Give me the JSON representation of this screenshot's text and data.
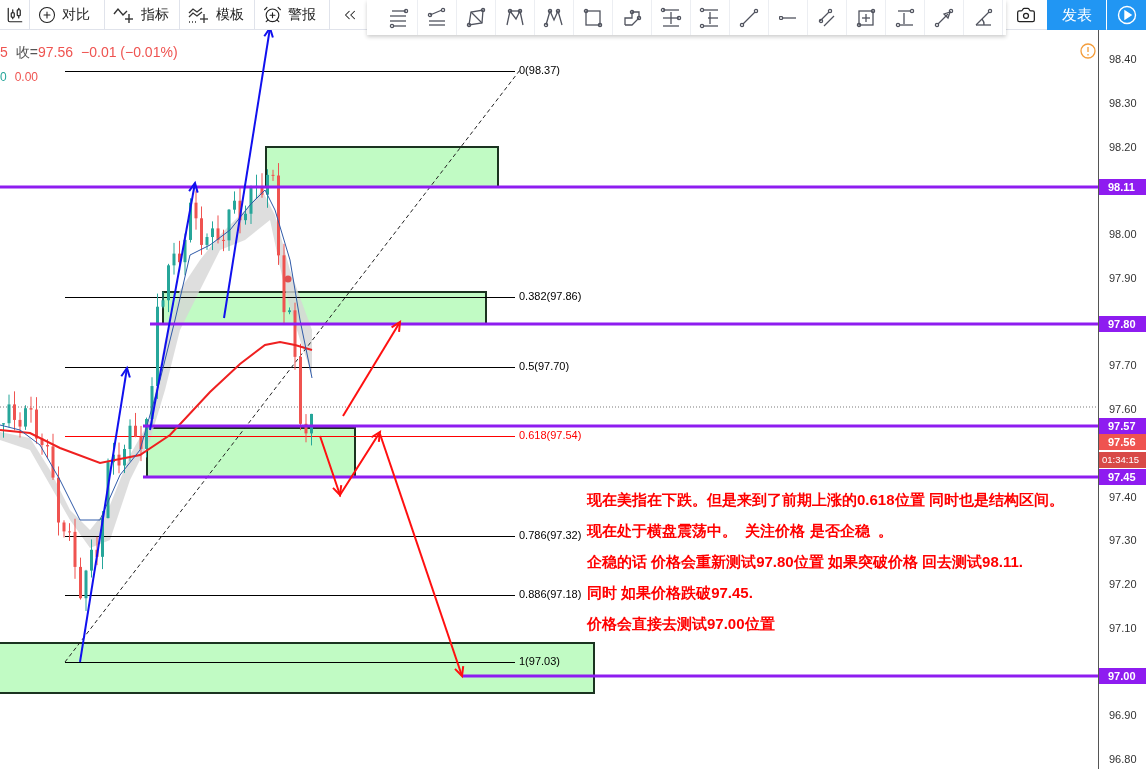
{
  "toolbar": {
    "items": [
      {
        "kind": "candles"
      },
      {
        "kind": "compare",
        "label": "对比"
      },
      {
        "kind": "indicator",
        "label": "指标"
      },
      {
        "kind": "template",
        "label": "模板"
      },
      {
        "kind": "alert",
        "label": "警报"
      },
      {
        "kind": "rewind"
      }
    ]
  },
  "publish_button": {
    "label": "发表"
  },
  "legend": {
    "period": "5",
    "close_label": "收=",
    "close": "97.56",
    "change": "−0.01 (−0.01%)",
    "indicator_prefix": "0",
    "indicator_value": "0.00"
  },
  "fib_levels": [
    {
      "label": "0(98.37)",
      "color": "#000000"
    },
    {
      "label": "0.382(97.86)",
      "color": "#000000"
    },
    {
      "label": "0.5(97.70)",
      "color": "#000000"
    },
    {
      "label": "0.618(97.54)",
      "color": "#ff0000"
    },
    {
      "label": "0.786(97.32)",
      "color": "#000000"
    },
    {
      "label": "0.886(97.18)",
      "color": "#000000"
    },
    {
      "label": "1(97.03)",
      "color": "#000000"
    }
  ],
  "price_axis": {
    "ticks": [
      "98.40",
      "98.30",
      "98.20",
      "98.00",
      "97.90",
      "97.70",
      "97.60",
      "97.40",
      "97.30",
      "97.20",
      "97.10",
      "96.90",
      "96.80"
    ],
    "tags": [
      {
        "kind": "line",
        "label": "98.11"
      },
      {
        "kind": "line",
        "label": "97.80"
      },
      {
        "kind": "line",
        "label": "97.57"
      },
      {
        "kind": "price",
        "label": "97.56"
      },
      {
        "kind": "countdown",
        "label": "01:34:15"
      },
      {
        "kind": "line",
        "label": "97.45"
      },
      {
        "kind": "line",
        "label": "97.00"
      }
    ]
  },
  "notes": [
    "现在美指在下跌。但是来到了前期上涨的0.618位置 同时也是结构区间。",
    "现在处于横盘震荡中。  关注价格 是否企稳  。",
    "企稳的话 价格会重新测试97.80位置 如果突破价格 回去测试98.11.",
    "同时 如果价格跌破97.45.",
    "价格会直接去测试97.00位置"
  ]
}
